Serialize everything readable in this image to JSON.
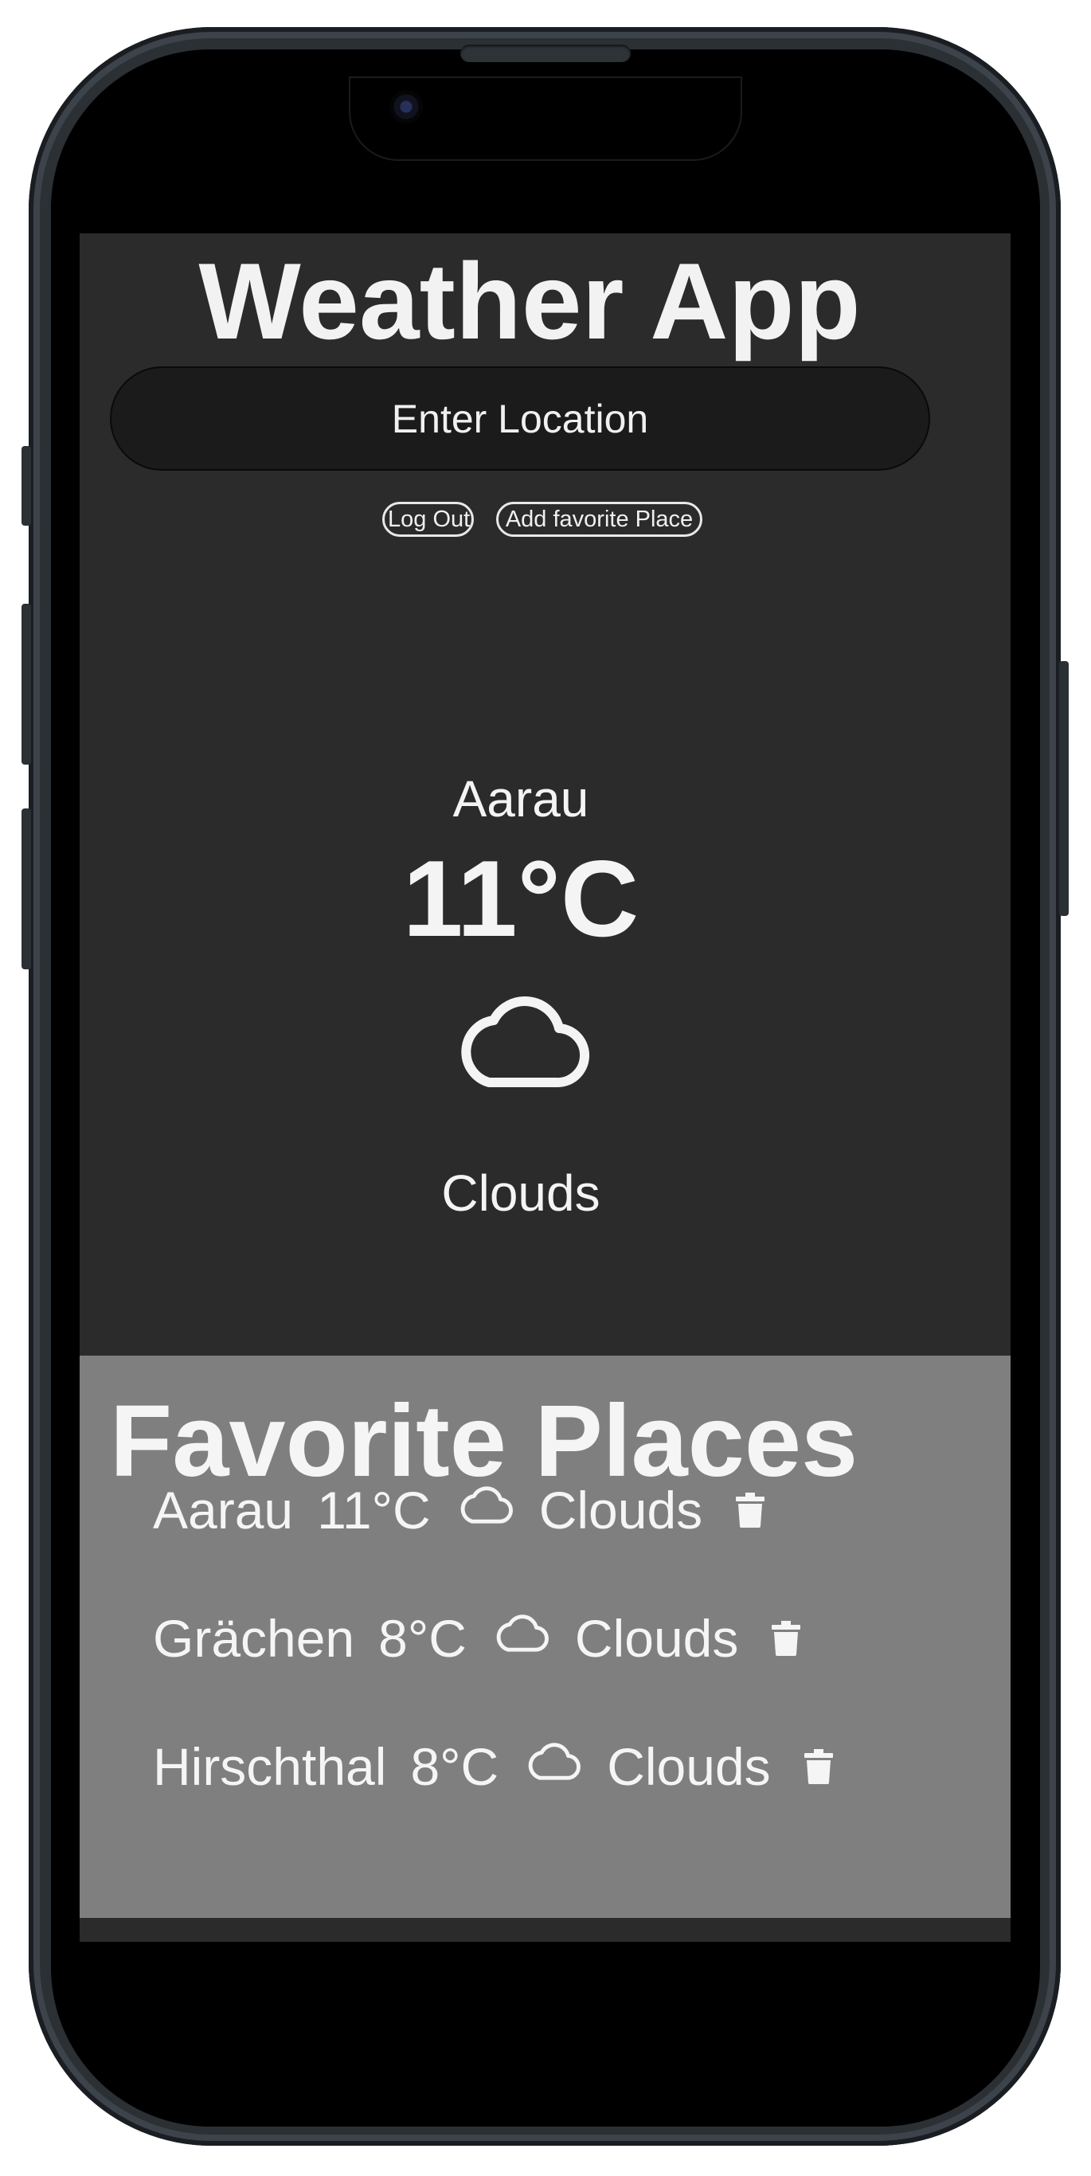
{
  "app": {
    "title": "Weather App"
  },
  "search": {
    "placeholder": "Enter Location"
  },
  "buttons": {
    "logout_label": "Log Out",
    "add_favorite_label": "Add favorite Place"
  },
  "current": {
    "city": "Aarau",
    "temperature": "11°C",
    "condition_icon": "cloud-icon",
    "condition": "Clouds"
  },
  "favorites": {
    "title": "Favorite Places",
    "items": [
      {
        "city": "Aarau",
        "temperature": "11°C",
        "icon": "cloud-icon",
        "condition": "Clouds",
        "action_icon": "trash-icon"
      },
      {
        "city": "Grächen",
        "temperature": "8°C",
        "icon": "cloud-icon",
        "condition": "Clouds",
        "action_icon": "trash-icon"
      },
      {
        "city": "Hirschthal",
        "temperature": "8°C",
        "icon": "cloud-icon",
        "condition": "Clouds",
        "action_icon": "trash-icon"
      }
    ]
  },
  "colors": {
    "app_background": "#2b2b2b",
    "favorites_background": "#7f7f7f",
    "input_background": "#1b1b1b",
    "text": "#f4f4f4"
  }
}
